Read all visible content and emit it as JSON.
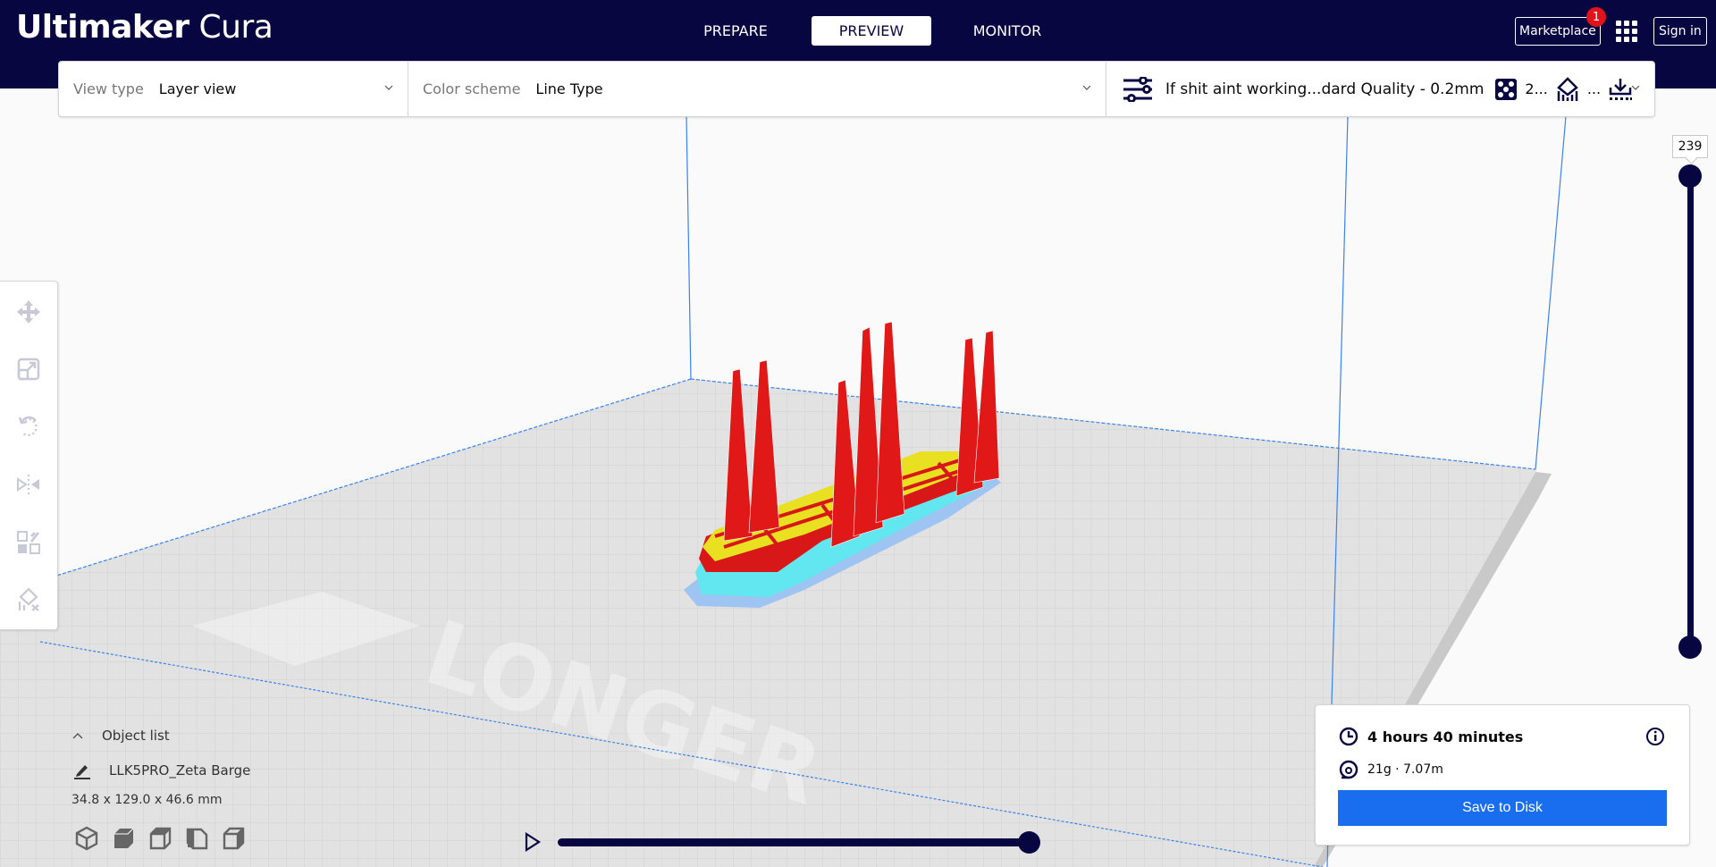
{
  "app": {
    "title_bold": "Ultimaker",
    "title_light": "Cura"
  },
  "header": {
    "stages": [
      {
        "label": "PREPARE",
        "active": false
      },
      {
        "label": "PREVIEW",
        "active": true
      },
      {
        "label": "MONITOR",
        "active": false
      }
    ],
    "marketplace_label": "Marketplace",
    "marketplace_badge": "1",
    "sign_in_label": "Sign in"
  },
  "toolbar": {
    "view_type_label": "View type",
    "view_type_value": "Layer view",
    "color_scheme_label": "Color scheme",
    "color_scheme_value": "Line Type",
    "print_profile": "If shit aint working...dard Quality - 0.2mm",
    "infill_value": "2...",
    "support_value": "..."
  },
  "layer_slider": {
    "current_layer": "239",
    "upper_fraction": 1.0,
    "lower_fraction": 0.0
  },
  "left_tools": [
    {
      "name": "move-icon"
    },
    {
      "name": "scale-icon"
    },
    {
      "name": "rotate-icon"
    },
    {
      "name": "mirror-icon"
    },
    {
      "name": "per-model-settings-icon"
    },
    {
      "name": "support-blocker-icon"
    }
  ],
  "object_list": {
    "header_label": "Object list",
    "object_name": "LLK5PRO_Zeta Barge",
    "dimensions": "34.8 x 129.0 x 46.6 mm"
  },
  "view_orientations": [
    {
      "name": "view-3d-icon"
    },
    {
      "name": "view-front-icon"
    },
    {
      "name": "view-top-icon"
    },
    {
      "name": "view-left-icon"
    },
    {
      "name": "view-right-icon"
    }
  ],
  "simulation": {
    "progress_fraction": 1.0
  },
  "print_info": {
    "time": "4 hours 40 minutes",
    "material": "21g · 7.07m",
    "save_label": "Save to Disk"
  },
  "bed_logo_text": "LONGER",
  "colors": {
    "header_bg": "#080640",
    "accent_blue": "#196ef0",
    "badge_red": "#e1141c",
    "wall_red": "#e01818",
    "skin_yellow": "#f0f000",
    "support_cyan": "#5ee8f0",
    "skirt_blue": "#8ec8f0"
  }
}
